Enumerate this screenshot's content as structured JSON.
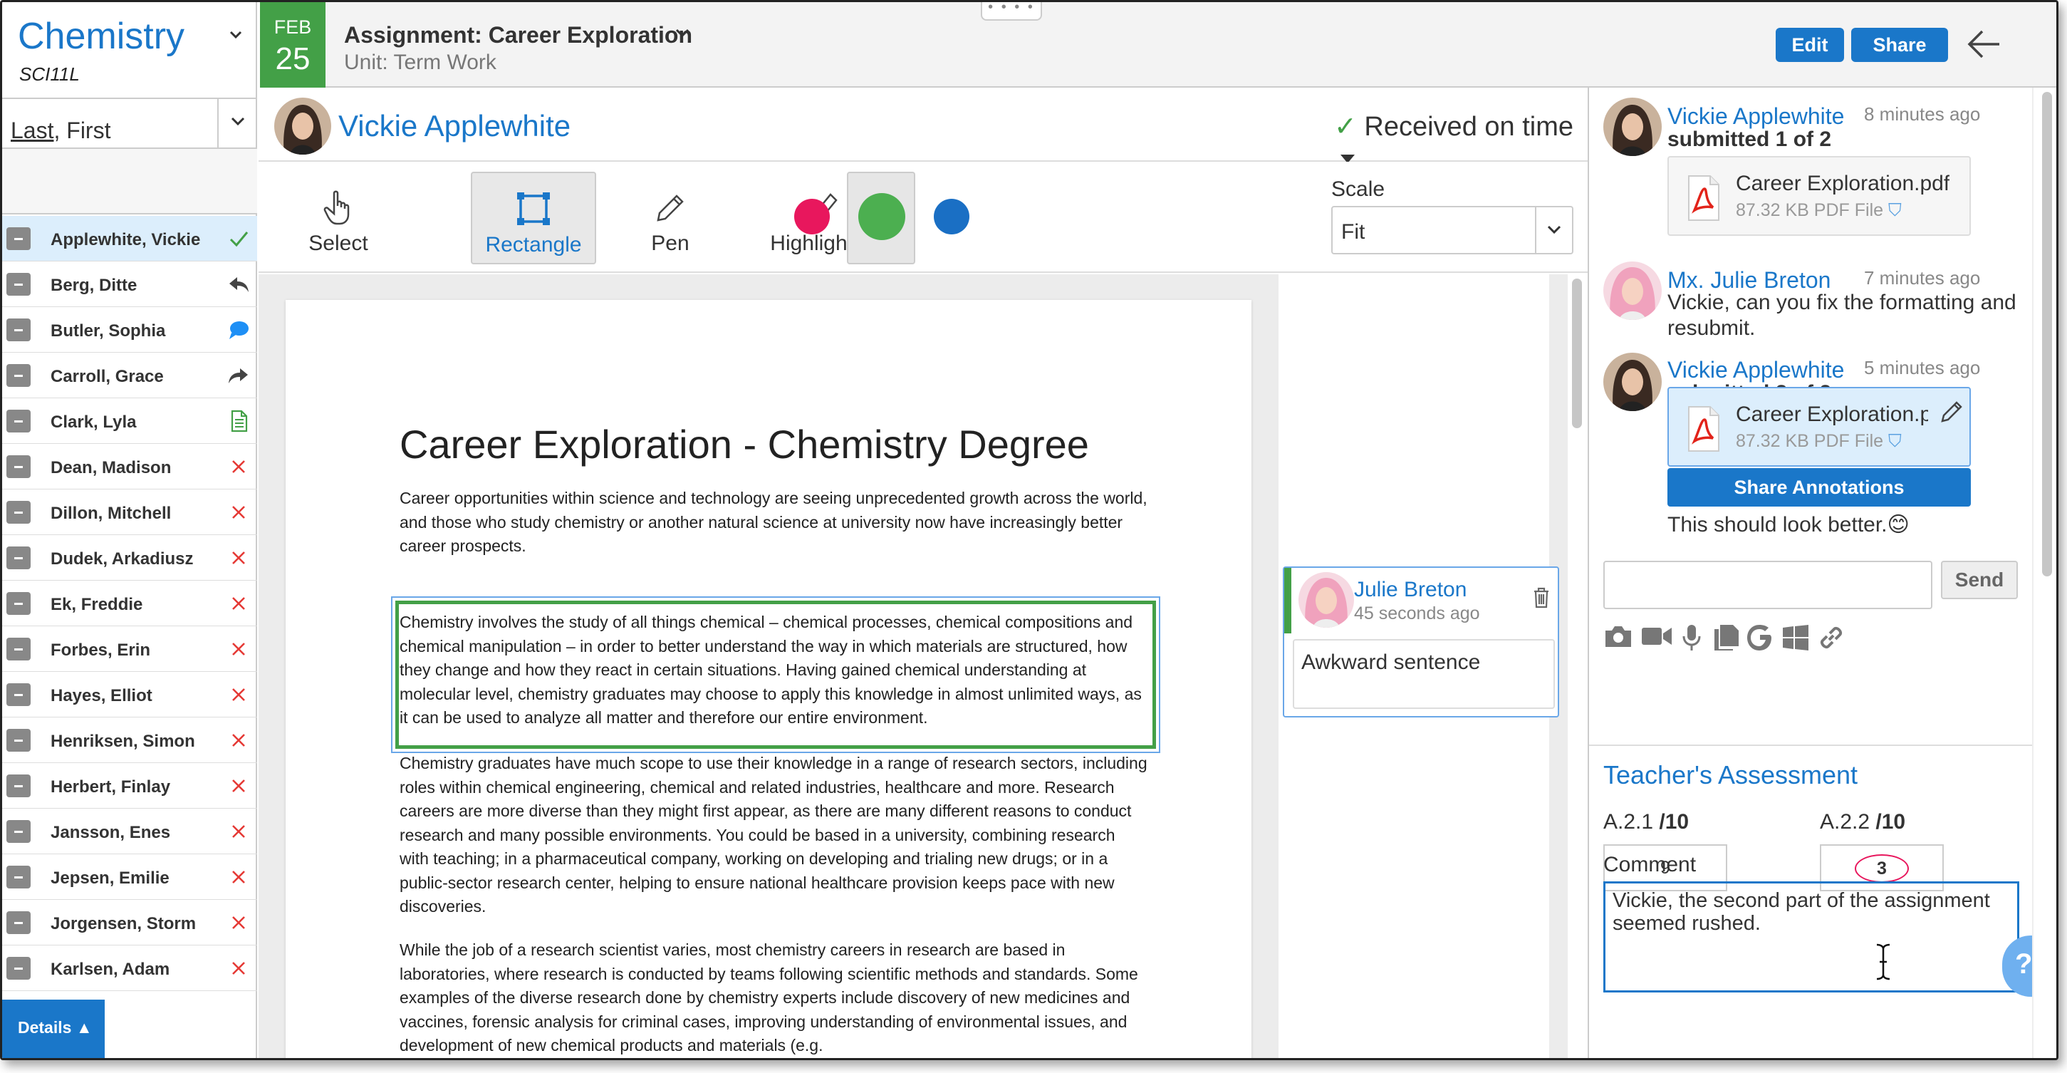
{
  "course": {
    "title": "Chemistry",
    "code": "SCI11L"
  },
  "sort": {
    "label_last": "Last",
    "label_rest": ", First"
  },
  "students": [
    {
      "name": "Applewhite, Vickie",
      "status": "check-icon"
    },
    {
      "name": "Berg, Ditte",
      "status": "reply-icon"
    },
    {
      "name": "Butler, Sophia",
      "status": "speech-bubble-icon"
    },
    {
      "name": "Carroll, Grace",
      "status": "forward-icon"
    },
    {
      "name": "Clark, Lyla",
      "status": "document-icon"
    },
    {
      "name": "Dean, Madison",
      "status": "cross-icon"
    },
    {
      "name": "Dillon, Mitchell",
      "status": "cross-icon"
    },
    {
      "name": "Dudek, Arkadiusz",
      "status": "cross-icon"
    },
    {
      "name": "Ek, Freddie",
      "status": "cross-icon"
    },
    {
      "name": "Forbes, Erin",
      "status": "cross-icon"
    },
    {
      "name": "Hayes, Elliot",
      "status": "cross-icon"
    },
    {
      "name": "Henriksen, Simon",
      "status": "cross-icon"
    },
    {
      "name": "Herbert, Finlay",
      "status": "cross-icon"
    },
    {
      "name": "Jansson, Enes",
      "status": "cross-icon"
    },
    {
      "name": "Jepsen, Emilie",
      "status": "cross-icon"
    },
    {
      "name": "Jorgensen, Storm",
      "status": "cross-icon"
    },
    {
      "name": "Karlsen, Adam",
      "status": "cross-icon"
    }
  ],
  "details_label": "Details ▲",
  "date": {
    "month": "FEB",
    "day": "25"
  },
  "assignment": {
    "title": "Assignment: Career Exploration",
    "unit": "Unit: Term Work"
  },
  "drag_handle": "• • • •",
  "header_buttons": {
    "edit": "Edit",
    "share": "Share"
  },
  "student": {
    "name": "Vickie Applewhite",
    "status_check": "✓",
    "status": "Received on time"
  },
  "tools": {
    "select": "Select",
    "rectangle": "Rectangle",
    "pen": "Pen",
    "highlighter": "Highlighter"
  },
  "colors": {
    "accent": "#1a77c9",
    "red": "#e8175d",
    "green": "#4caf50",
    "blue": "#1a6fc4",
    "status_green": "#43a047"
  },
  "scale": {
    "label": "Scale",
    "value": "Fit"
  },
  "document": {
    "title": "Career Exploration - Chemistry Degree",
    "p1": "Career opportunities within science and technology are seeing unprecedented growth across the world, and those who study chemistry or another natural science at university now have increasingly better career prospects.",
    "p2": "Chemistry involves the study of all things chemical – chemical processes, chemical compositions and chemical manipulation – in order to better understand the way in which materials are structured, how they change and how they react in certain situations. Having gained chemical understanding at molecular level, chemistry graduates may choose to apply this knowledge in almost unlimited ways, as it can be used to analyze all matter and therefore our entire environment.",
    "p3": "Chemistry graduates have much scope to use their knowledge in a range of research sectors, including roles within chemical engineering, chemical and related industries, healthcare and more. Research careers are more diverse than they might first appear, as there are many different reasons to conduct research and many possible environments. You could be based in a university, combining research with teaching; in a pharmaceutical company, working on developing and trialing new drugs; or in a public-sector research center, helping to ensure national healthcare provision keeps pace with new discoveries.",
    "p4": "While the job of a research scientist varies, most chemistry careers in research are based in laboratories, where research is conducted by teams following scientific methods and standards. Some examples of the diverse research done by chemistry experts include discovery of new medicines and vaccines, forensic analysis for criminal cases, improving understanding of environmental issues, and development of new chemical products and materials (e.g."
  },
  "annotation_comment": {
    "author": "Julie Breton",
    "time": "45 seconds ago",
    "text": "Awkward sentence"
  },
  "messages": [
    {
      "author": "Vickie Applewhite",
      "time": "8 minutes ago",
      "line": "submitted 1 of 2",
      "file": "Career Exploration.pdf",
      "meta": "87.32 KB PDF File"
    },
    {
      "author": "Mx. Julie Breton",
      "time": "7 minutes ago",
      "text": "Vickie, can you fix the formatting and resubmit."
    },
    {
      "author": "Vickie Applewhite",
      "time": "5 minutes ago",
      "line": "submitted 2 of 2",
      "file": "Career Exploration.pdf",
      "meta": "87.32 KB PDF File",
      "button": "Share Annotations",
      "note": "This should look better.😊"
    }
  ],
  "chat": {
    "send": "Send"
  },
  "assessment": {
    "title": "Teacher's Assessment",
    "criteria": [
      {
        "code": "A.2.1",
        "max": "/10",
        "score": "9"
      },
      {
        "code": "A.2.2",
        "max": "/10",
        "score": "3"
      }
    ],
    "comment_label": "Comment",
    "comment": "Vickie, the second part of the assignment seemed rushed."
  },
  "help_label": "?"
}
